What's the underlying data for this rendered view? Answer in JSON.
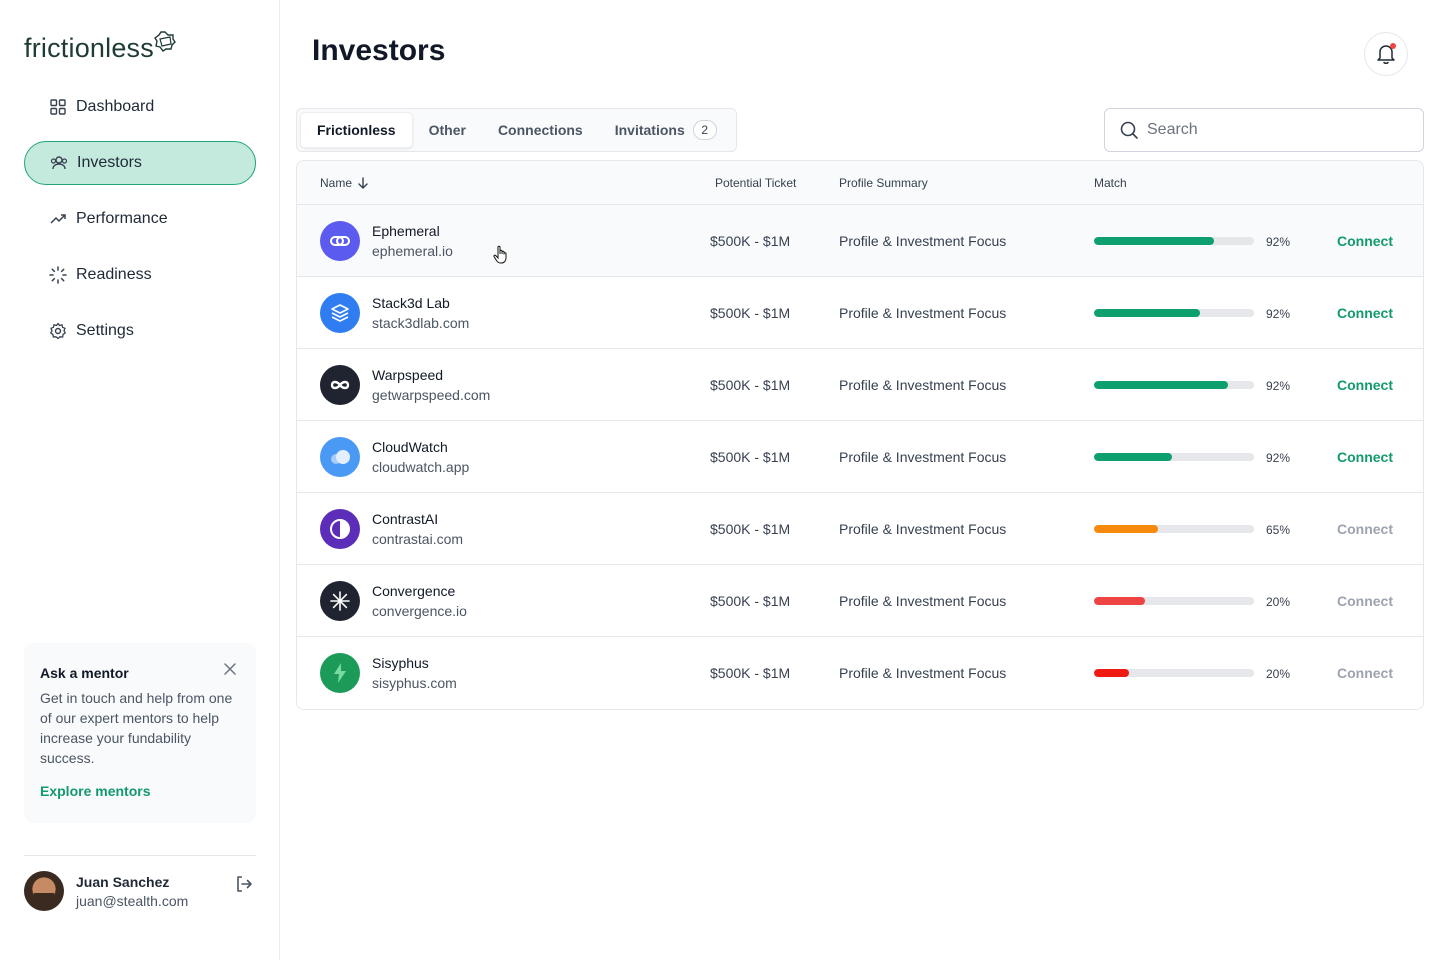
{
  "brand": {
    "name": "frictionless"
  },
  "sidebar": {
    "items": [
      {
        "label": "Dashboard",
        "icon": "grid-icon"
      },
      {
        "label": "Investors",
        "icon": "users-icon",
        "active": true
      },
      {
        "label": "Performance",
        "icon": "trend-up-icon"
      },
      {
        "label": "Readiness",
        "icon": "loader-icon"
      },
      {
        "label": "Settings",
        "icon": "gear-icon"
      }
    ],
    "mentor": {
      "title": "Ask a mentor",
      "text": "Get in touch and help from one of our expert mentors to help increase your fundability success.",
      "link": "Explore mentors"
    },
    "user": {
      "name": "Juan Sanchez",
      "email": "juan@stealth.com"
    }
  },
  "header": {
    "title": "Investors"
  },
  "tabs": [
    {
      "label": "Frictionless",
      "active": true
    },
    {
      "label": "Other"
    },
    {
      "label": "Connections"
    },
    {
      "label": "Invitations",
      "badge": "2"
    }
  ],
  "search": {
    "placeholder": "Search"
  },
  "table": {
    "columns": {
      "name": "Name",
      "ticket": "Potential Ticket",
      "summary": "Profile Summary",
      "match": "Match"
    },
    "action_label": "Connect",
    "rows": [
      {
        "name": "Ephemeral",
        "domain": "ephemeral.io",
        "ticket": "$500K - $1M",
        "summary": "Profile & Investment Focus",
        "match": "92%",
        "fill": 0.75,
        "color": "#0e9f6e",
        "connect_active": true,
        "logo_bg": "#5b5bf0",
        "logo_icon": "chain-link-icon"
      },
      {
        "name": "Stack3d Lab",
        "domain": "stack3dlab.com",
        "ticket": "$500K - $1M",
        "summary": "Profile & Investment Focus",
        "match": "92%",
        "fill": 0.66,
        "color": "#0e9f6e",
        "connect_active": true,
        "logo_bg": "#2f7df0",
        "logo_icon": "stack-icon"
      },
      {
        "name": "Warpspeed",
        "domain": "getwarpspeed.com",
        "ticket": "$500K - $1M",
        "summary": "Profile & Investment Focus",
        "match": "92%",
        "fill": 0.84,
        "color": "#0e9f6e",
        "connect_active": true,
        "logo_bg": "#1f2430",
        "logo_icon": "infinity-icon"
      },
      {
        "name": "CloudWatch",
        "domain": "cloudwatch.app",
        "ticket": "$500K - $1M",
        "summary": "Profile & Investment Focus",
        "match": "92%",
        "fill": 0.49,
        "color": "#0e9f6e",
        "connect_active": true,
        "logo_bg": "#4a9af5",
        "logo_icon": "cloud-icon"
      },
      {
        "name": "ContrastAI",
        "domain": "contrastai.com",
        "ticket": "$500K - $1M",
        "summary": "Profile & Investment Focus",
        "match": "65%",
        "fill": 0.4,
        "color": "#f7890c",
        "connect_active": false,
        "logo_bg": "#5b2db8",
        "logo_icon": "half-circle-icon"
      },
      {
        "name": "Convergence",
        "domain": "convergence.io",
        "ticket": "$500K - $1M",
        "summary": "Profile & Investment Focus",
        "match": "20%",
        "fill": 0.32,
        "color": "#ef4444",
        "connect_active": false,
        "logo_bg": "#1f2430",
        "logo_icon": "asterisk-icon"
      },
      {
        "name": "Sisyphus",
        "domain": "sisyphus.com",
        "ticket": "$500K - $1M",
        "summary": "Profile & Investment Focus",
        "match": "20%",
        "fill": 0.22,
        "color": "#ef1b12",
        "connect_active": false,
        "logo_bg": "#1c9b58",
        "logo_icon": "bolt-icon"
      }
    ]
  },
  "colors": {
    "accent": "#139a6c",
    "connect_disabled": "#9ca3af"
  }
}
